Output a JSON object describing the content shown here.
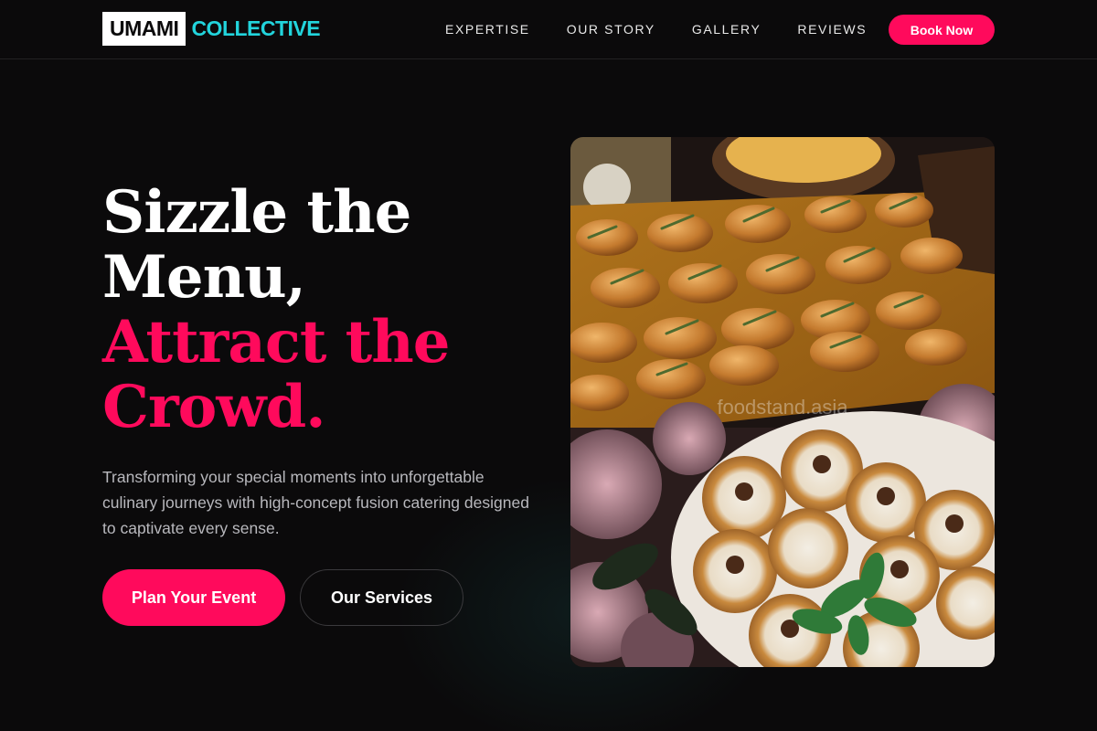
{
  "brand": {
    "name": "UMAMI",
    "accent": "COLLECTIVE"
  },
  "nav": {
    "items": [
      {
        "label": "EXPERTISE"
      },
      {
        "label": "OUR STORY"
      },
      {
        "label": "GALLERY"
      },
      {
        "label": "REVIEWS"
      }
    ],
    "cta_label": "Book Now"
  },
  "hero": {
    "headline_lines": [
      "Sizzle the",
      "Menu,"
    ],
    "headline_accent_lines": [
      "Attract the",
      "Crowd."
    ],
    "subtitle": "Transforming your special moments into unforgettable culinary journeys with high-concept fusion catering designed to captivate every sense.",
    "primary_button": "Plan Your Event",
    "secondary_button": "Our Services",
    "image_watermark": "foodstand.asia"
  },
  "colors": {
    "background": "#0b0a0b",
    "accent_pink": "#ff0a5c",
    "accent_cyan": "#22d4dc",
    "muted_text": "#b8b8bd"
  }
}
